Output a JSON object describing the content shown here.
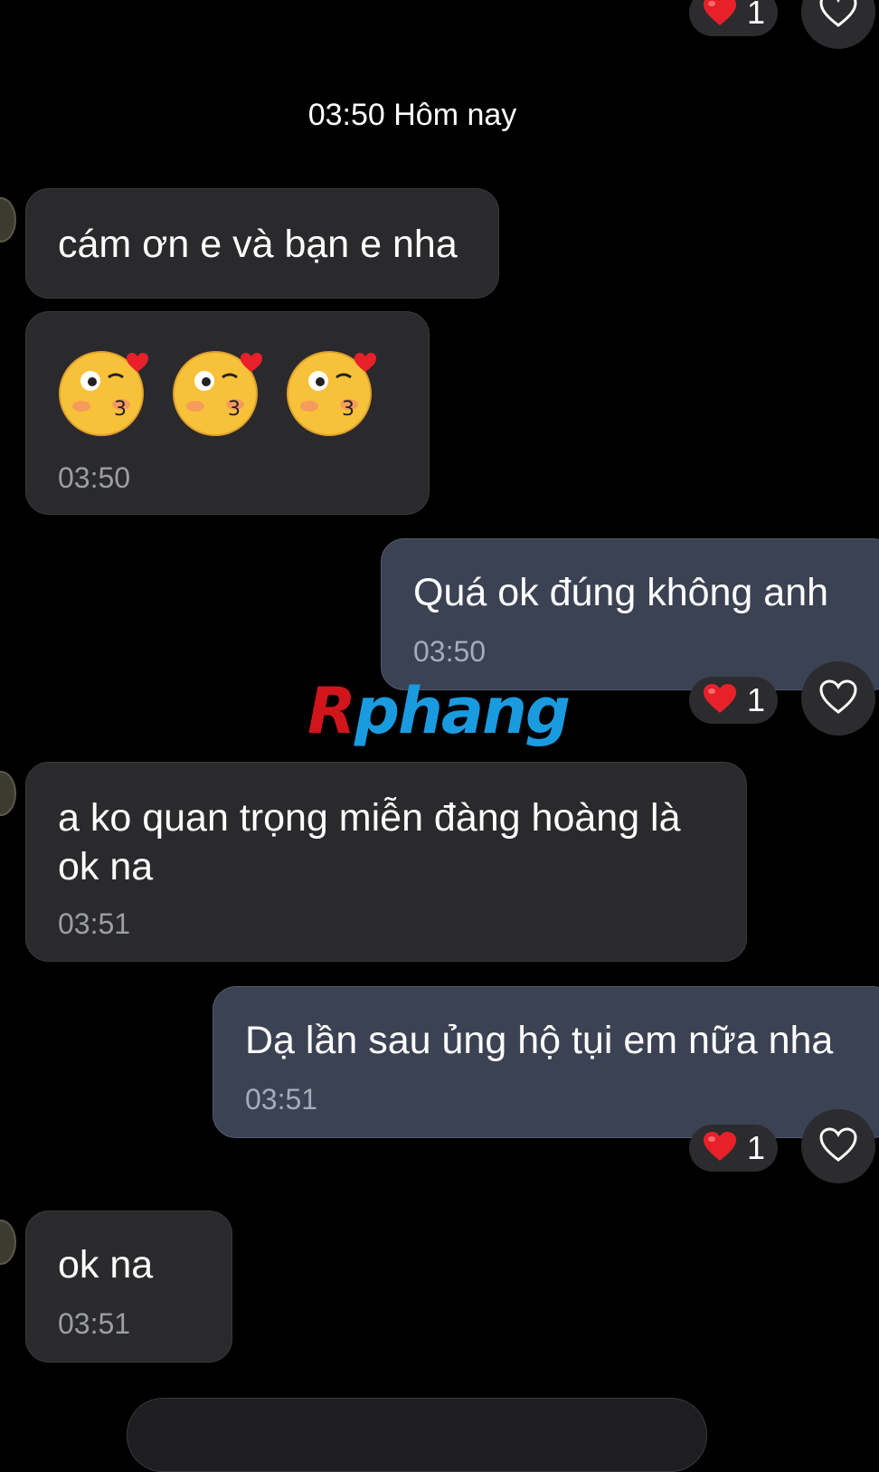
{
  "date_separator": "03:50 Hôm nay",
  "messages": [
    {
      "text": "cám ơn e và bạn e nha"
    },
    {
      "text": "",
      "time": "03:50",
      "emojis": [
        "kiss-heart-emoji",
        "kiss-heart-emoji",
        "kiss-heart-emoji"
      ]
    },
    {
      "text": "Quá ok đúng không anh",
      "time": "03:50",
      "reaction_count": "1"
    },
    {
      "text_line1": "a ko quan trọng miễn đàng hoàng là",
      "text_line2": "ok na",
      "time": "03:51"
    },
    {
      "text": "Dạ lần sau ủng hộ tụi em nữa nha",
      "time": "03:51",
      "reaction_count": "1"
    },
    {
      "text": "ok na",
      "time": "03:51"
    }
  ],
  "top_reaction_count": "1",
  "watermark": {
    "part1": "R",
    "part2": "phang"
  },
  "colors": {
    "incoming_bubble": "#2a2a2c",
    "outgoing_bubble": "#3b4253",
    "heart": "#e8202a",
    "background": "#000000"
  }
}
